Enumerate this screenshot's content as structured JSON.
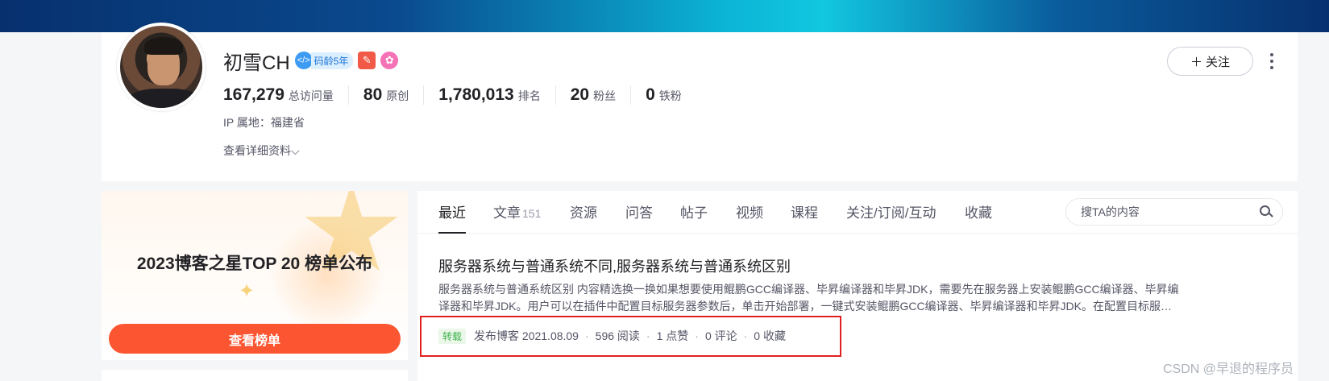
{
  "profile": {
    "name": "初雪CH",
    "code_age_icon": "</>",
    "code_age": "码龄5年",
    "stats": [
      {
        "value": "167,279",
        "label": "总访问量"
      },
      {
        "value": "80",
        "label": "原创"
      },
      {
        "value": "1,780,013",
        "label": "排名"
      },
      {
        "value": "20",
        "label": "粉丝"
      },
      {
        "value": "0",
        "label": "铁粉"
      }
    ],
    "ip_location": "IP 属地：福建省",
    "detail_link": "查看详细资料",
    "follow_label": "关注",
    "follow_icon": "＋",
    "detail_chevron": "⌵"
  },
  "promo": {
    "title": "2023博客之星TOP 20 榜单公布",
    "button": "查看榜单"
  },
  "tabs": [
    {
      "label": "最近",
      "count": ""
    },
    {
      "label": "文章",
      "count": "151"
    },
    {
      "label": "资源",
      "count": ""
    },
    {
      "label": "问答",
      "count": ""
    },
    {
      "label": "帖子",
      "count": ""
    },
    {
      "label": "视频",
      "count": ""
    },
    {
      "label": "课程",
      "count": ""
    },
    {
      "label": "关注/订阅/互动",
      "count": ""
    },
    {
      "label": "收藏",
      "count": ""
    }
  ],
  "search": {
    "placeholder": "搜TA的内容"
  },
  "article": {
    "title": "服务器系统与普通系统不同,服务器系统与普通系统区别",
    "desc_line1": "服务器系统与普通系统区别 内容精选换一换如果想要使用鲲鹏GCC编译器、毕昇编译器和毕昇JDK，需要先在服务器上安装鲲鹏GCC编译器、毕昇编",
    "desc_line2": "译器和毕昇JDK。用户可以在插件中配置目标服务器参数后，单击开始部署，一键式安装鲲鹏GCC编译器、毕昇编译器和毕昇JDK。在配置目标服…",
    "tag": "转载",
    "publish": "发布博客 2021.08.09",
    "reads": "596 阅读",
    "likes": "1 点赞",
    "comments": "0 评论",
    "favorites": "0 收藏",
    "separator": "·"
  },
  "watermark": "CSDN @早退的程序员",
  "colors": {
    "accent": "#fc5531",
    "highlight_border": "#e02020",
    "repost_tag": "#3cb34a"
  }
}
